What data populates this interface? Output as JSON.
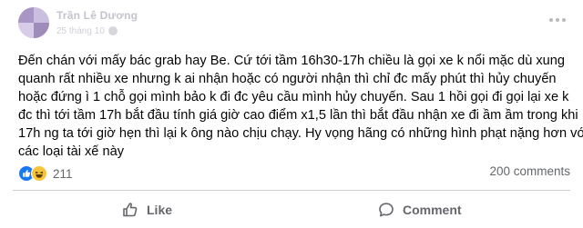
{
  "post": {
    "author": "Trần Lê Dương",
    "time": "25 tháng 10",
    "text_lines": [
      "Đến chán với mấy bác grab hay Be. Cứ tới tầm 16h30-17h chiều là gọi xe k nổi mặc dù xung",
      "quanh rất nhiều xe nhưng k ai nhận hoặc có người nhận thì chỉ đc mấy phút thì hủy chuyến",
      "hoặc đứng ì 1 chỗ gọi mình bảo k đi đc yêu cầu mình hủy chuyến. Sau 1 hồi gọi đi gọi lại xe k",
      "đc thì tới tầm 17h bắt đầu tính giá giờ cao điểm x1,5 lần thì bắt đầu nhận xe đi ầm ầm trong khi",
      "17h ng ta tới giờ hẹn thì lại k ông nào chịu chạy. Hy vọng hãng có những hình phạt nặng hơn với",
      "các loại tài xế này"
    ]
  },
  "reactions": {
    "count": "211",
    "icons": [
      "like-icon",
      "haha-icon"
    ],
    "like_color": "#1877f2",
    "haha_color": "#f7c53a"
  },
  "comments_count": "200 comments",
  "actions": {
    "like_label": "Like",
    "comment_label": "Comment"
  }
}
